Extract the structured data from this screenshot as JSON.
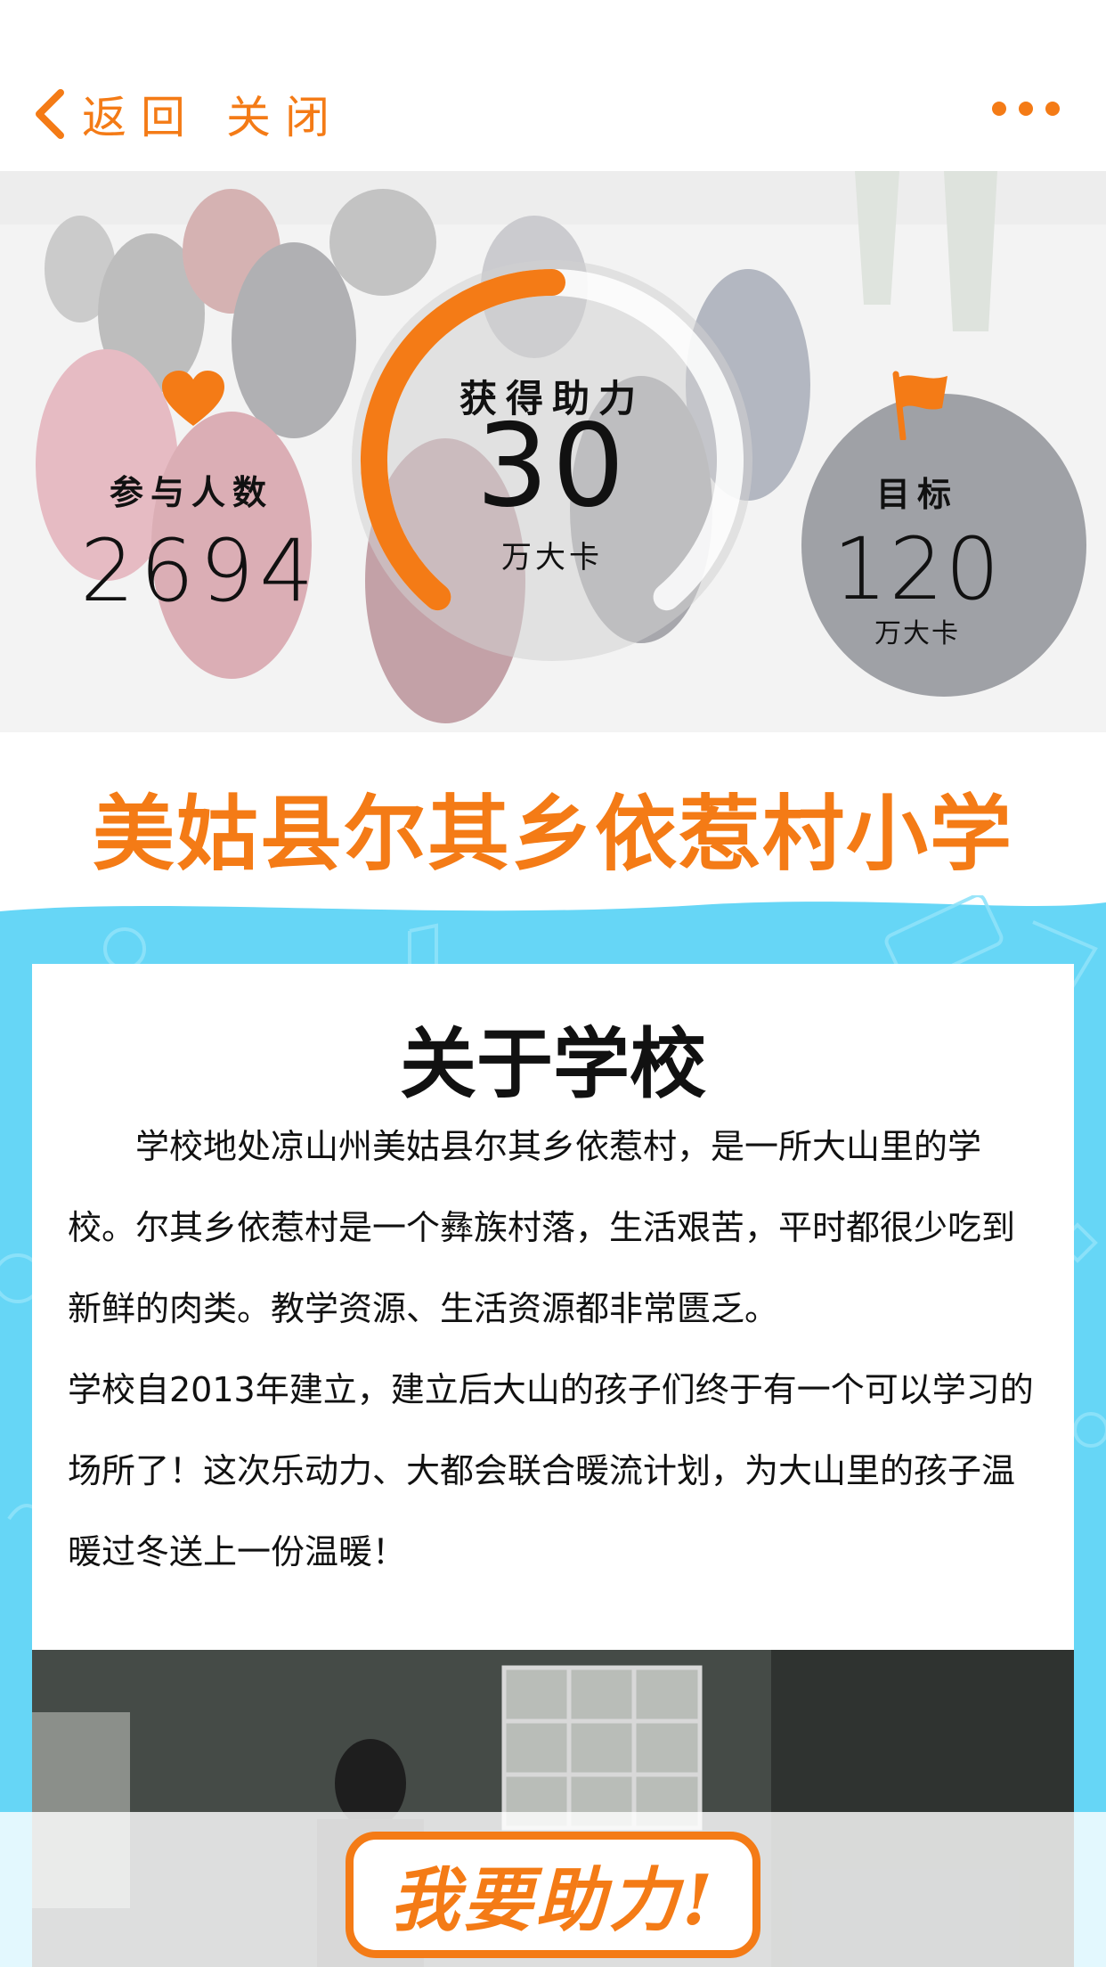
{
  "nav": {
    "back_label": "返回",
    "close_label": "关闭",
    "more_icon": "more-dots-icon",
    "accent_color": "#f47b16"
  },
  "stats": {
    "participants_label": "参与人数",
    "participants_value": "2694",
    "progress_label": "获得助力",
    "progress_value": "30",
    "progress_unit": "万大卡",
    "target_label": "目标",
    "target_value": "120",
    "target_unit": "万大卡",
    "progress_fraction": 0.25
  },
  "school": {
    "name": "美姑县尔其乡依惹村小学"
  },
  "about": {
    "title": "关于学校",
    "paragraph_1": "学校地处凉山州美姑县尔其乡依惹村，是一所大山里的学校。尔其乡依惹村是一个彝族村落，生活艰苦，平时都很少吃到新鲜的肉类。教学资源、生活资源都非常匮乏。",
    "paragraph_2": "学校自2013年建立，建立后大山的孩子们终于有一个可以学习的场所了！这次乐动力、大都会联合暖流计划，为大山里的孩子温暖过冬送上一份温暖！"
  },
  "cta": {
    "label": "我要助力!"
  },
  "colors": {
    "orange": "#f47b16",
    "sky_blue": "#66d6f6",
    "ring_track": "#ffffff"
  }
}
